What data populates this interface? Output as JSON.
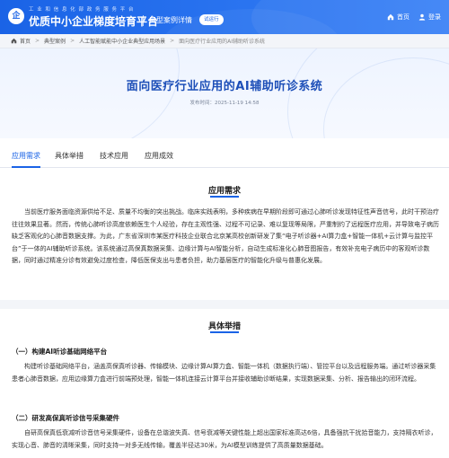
{
  "header": {
    "logo_char": "企",
    "subtitle": "工 业 和 信 息 化 部 政 务 服 务 平 台",
    "title": "优质中小企业梯度培育平台",
    "section": "典型案例详情",
    "badge": "试运行",
    "links": [
      {
        "icon": "home-icon",
        "label": "首页"
      },
      {
        "icon": "login-icon",
        "label": "登录"
      }
    ]
  },
  "breadcrumb": {
    "items": [
      "首页",
      "典型案例",
      "人工智能赋能中小企业典型应用场景",
      "面向医疗行业应用的AI辅助听诊系统"
    ],
    "separator": ">"
  },
  "banner": {
    "title": "面向医疗行业应用的AI辅助听诊系统",
    "date": "发布时间：2025-11-19 14:58"
  },
  "tabs": [
    {
      "label": "应用需求",
      "active": true
    },
    {
      "label": "具体举措",
      "active": false
    },
    {
      "label": "技术应用",
      "active": false
    },
    {
      "label": "应用成效",
      "active": false
    }
  ],
  "section1": {
    "heading": "应用需求",
    "paragraph": "当前医疗服务面临资源供给不足、质量不均衡的突出挑战。临床实践表明，多种疾病在早期阶段即可通过心肺听诊发现特征性声音信号，此时干预治疗往往效果显著。然而，传统心肺听诊高度依赖医生个人经验，存在主观性强、过程不可记录、难以复现等局限，严重制约了远程医疗应用，并导致电子病历缺乏客观化的心肺音数据支撑。为此，广东省深圳市某医疗科技企业联合北京某高校创新研发了集“电子听诊器+AI算力盒+智能一体机+云计算与监控平台”于一体的AI辅助听诊系统。该系统通过高保真数据采集、边缘计算与AI智能分析，自动生成标准化心肺音图报告，有效补充电子病历中的客观听诊数据，同时通过精准分诊有效避免过度检查，降低医保支出与患者负担，助力基层医疗的智能化升级与普惠化发展。"
  },
  "section2": {
    "heading": "具体举措",
    "sub1_title": "（一）构建AI听诊基础网络平台",
    "sub1_text": "构建听诊基础网络平台，涵盖高保真听诊器、传输模块、边缘计算AI算力盒、智能一体机（数据执行端）、管控平台以及远程服务端。通过听诊器采集患者心肺音数据，应用边缘算力盒进行前端预处理，智能一体机连接云计算平台并接收辅助诊断结果，实现数据采集、分析、报告输出的闭环流程。",
    "sub2_title": "（二）研发高保真听诊信号采集硬件",
    "sub2_text": "自研高保真低衰减听诊音信号采集硬件，设备在总谐波失真、信号衰减等关键性能上超出国家标准高达6倍，具备强抗干扰拾音能力，支持隔衣听诊，实现心音、肺音的清晰采集，同时支持一对多无线传输，覆盖半径达30米，为AI模型训练提供了高质量数据基础。"
  },
  "colors": {
    "primary": "#1a63e6",
    "title_blue": "#1d4fb8",
    "breadcrumb_bg": "#f3f5f9"
  }
}
